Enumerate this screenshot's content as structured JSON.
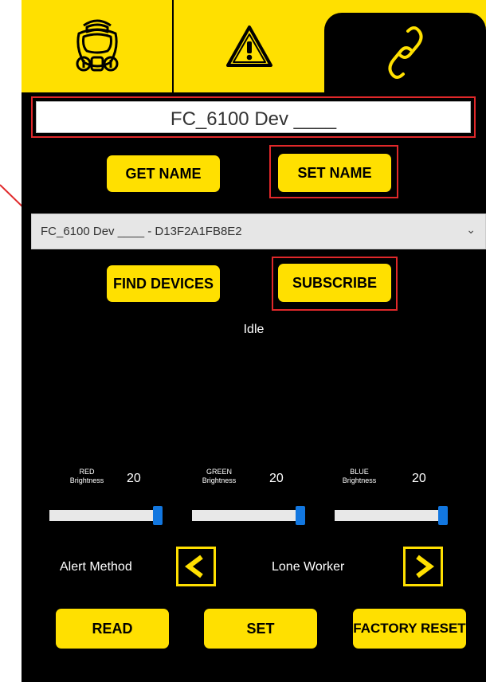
{
  "tabs": [
    {
      "name": "gas-mask-icon"
    },
    {
      "name": "warning-icon"
    },
    {
      "name": "link-icon"
    }
  ],
  "device_name_field": {
    "value": "FC_6100 Dev ____"
  },
  "buttons": {
    "get_name": "GET NAME",
    "set_name": "SET NAME",
    "find_devices": "FIND DEVICES",
    "subscribe": "SUBSCRIBE",
    "read": "READ",
    "set": "SET",
    "factory_reset": "FACTORY RESET"
  },
  "device_select": {
    "selected": "FC_6100 Dev ____ - D13F2A1FB8E2"
  },
  "status_text": "Idle",
  "brightness": {
    "red": {
      "label_line1": "RED",
      "label_line2": "Brightness",
      "value": "20",
      "level": 1.0
    },
    "green": {
      "label_line1": "GREEN",
      "label_line2": "Brightness",
      "value": "20",
      "level": 1.0
    },
    "blue": {
      "label_line1": "BLUE",
      "label_line2": "Brightness",
      "value": "20",
      "level": 1.0
    }
  },
  "alert": {
    "label": "Alert Method",
    "value": "Lone Worker"
  },
  "colors": {
    "accent": "#ffe000",
    "background": "#000000",
    "highlight": "#e0282a",
    "slider_thumb": "#1277e0"
  }
}
